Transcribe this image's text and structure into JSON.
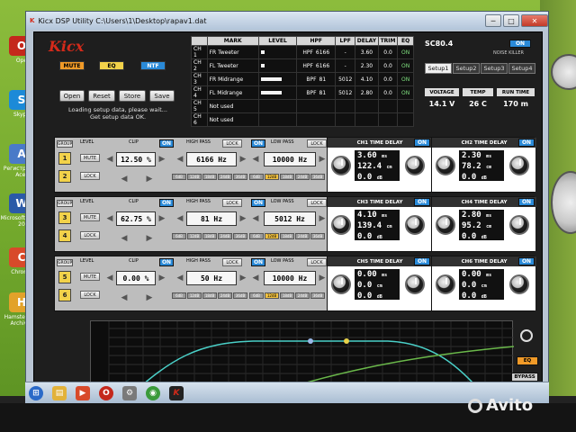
{
  "window": {
    "title": "Kicx DSP Utility   C:\\Users\\1\\Desktop\\rapav1.dat",
    "minimize": "─",
    "maximize": "□",
    "close": "✕"
  },
  "desktop_icons": [
    {
      "label": "Ope",
      "glyph": "O",
      "color": "#c4281c"
    },
    {
      "label": "Skype",
      "glyph": "S",
      "color": "#1c8ad8"
    },
    {
      "label": "Регистрация Acer",
      "glyph": "A",
      "color": "#4a7ac8"
    },
    {
      "label": "Microsoft Office 20",
      "glyph": "W",
      "color": "#2a5aa8"
    },
    {
      "label": "Chrome",
      "glyph": "C",
      "color": "#d84a2a"
    },
    {
      "label": "Hamster Lite Archiver",
      "glyph": "H",
      "color": "#e2a22a"
    }
  ],
  "header": {
    "logo": "Kicx",
    "mute_label": "MUTE",
    "eq_label": "EQ",
    "ntf_label": "NTF",
    "buttons": {
      "open": "Open",
      "reset": "Reset",
      "store": "Store",
      "save": "Save"
    },
    "status_lines": [
      "Loading setup data, please wait...",
      "Get setup data OK."
    ]
  },
  "channel_table": {
    "headers": [
      "",
      "MARK",
      "LEVEL",
      "HPF",
      "LPF",
      "DELAY",
      "TRIM",
      "EQ"
    ],
    "rows": [
      {
        "ch": "CH 1",
        "mark": "FR Tweeter",
        "level": 0.1,
        "hpf": "HPF",
        "hpf_val": "6166",
        "lpf": "-",
        "delay": "3.60",
        "trim": "0.0",
        "eq": "ON"
      },
      {
        "ch": "CH 2",
        "mark": "FL Tweeter",
        "level": 0.1,
        "hpf": "HPF",
        "hpf_val": "6166",
        "lpf": "-",
        "delay": "2.30",
        "trim": "0.0",
        "eq": "ON"
      },
      {
        "ch": "CH 3",
        "mark": "FR Midrange",
        "level": 0.6,
        "hpf": "BPF",
        "hpf_val": "81",
        "lpf": "5012",
        "delay": "4.10",
        "trim": "0.0",
        "eq": "ON"
      },
      {
        "ch": "CH 4",
        "mark": "FL Midrange",
        "level": 0.6,
        "hpf": "BPF",
        "hpf_val": "81",
        "lpf": "5012",
        "delay": "2.80",
        "trim": "0.0",
        "eq": "ON"
      },
      {
        "ch": "CH 5",
        "mark": "Not used",
        "level": 0.0,
        "hpf": "",
        "hpf_val": "",
        "lpf": "",
        "delay": "",
        "trim": "",
        "eq": ""
      },
      {
        "ch": "CH 6",
        "mark": "Not used",
        "level": 0.0,
        "hpf": "",
        "hpf_val": "",
        "lpf": "",
        "delay": "",
        "trim": "",
        "eq": ""
      }
    ]
  },
  "device": {
    "model": "SC80.4",
    "power": "ON",
    "noise_killer": "NOISE KILLER",
    "setups": [
      "Setup1",
      "Setup2",
      "Setup3",
      "Setup4"
    ],
    "readouts": [
      {
        "head": "VOLTAGE",
        "value": "14.1 V"
      },
      {
        "head": "TEMP",
        "value": "26 C"
      },
      {
        "head": "RUN TIME",
        "value": "170 m"
      }
    ]
  },
  "groups": [
    {
      "group_label": "GROUP",
      "nums": [
        "1",
        "2"
      ],
      "level_label": "LEVEL",
      "clip_label": "CLIP",
      "on_label": "ON",
      "mute_label": "MUTE",
      "lock_label": "LOCK",
      "level_value": "12.50 %",
      "hp_label": "HIGH PASS",
      "hp_lock": "LOCK",
      "hp_value": "6166 Hz",
      "lp_on": "ON",
      "lp_label": "LOW PASS",
      "lp_lock": "LOCK",
      "lp_value": "10000 Hz",
      "slopes": [
        "6dB",
        "12dB",
        "18dB",
        "24dB",
        "36dB"
      ],
      "td_a": {
        "title": "CH1 TIME DELAY",
        "on": "ON",
        "ms": "3.60",
        "cm": "122.4",
        "db": "0.0"
      },
      "td_b": {
        "title": "CH2 TIME DELAY",
        "on": "ON",
        "ms": "2.30",
        "cm": "78.2",
        "db": "0.0"
      }
    },
    {
      "group_label": "GROUP",
      "nums": [
        "3",
        "4"
      ],
      "level_label": "LEVEL",
      "clip_label": "CLIP",
      "on_label": "ON",
      "mute_label": "MUTE",
      "lock_label": "LOCK",
      "level_value": "62.75 %",
      "hp_label": "HIGH PASS",
      "hp_lock": "LOCK",
      "hp_value": "81 Hz",
      "lp_on": "ON",
      "lp_label": "LOW PASS",
      "lp_lock": "LOCK",
      "lp_value": "5012 Hz",
      "slopes": [
        "6dB",
        "12dB",
        "18dB",
        "24dB",
        "36dB"
      ],
      "td_a": {
        "title": "CH3 TIME DELAY",
        "on": "ON",
        "ms": "4.10",
        "cm": "139.4",
        "db": "0.0"
      },
      "td_b": {
        "title": "CH4 TIME DELAY",
        "on": "ON",
        "ms": "2.80",
        "cm": "95.2",
        "db": "0.0"
      }
    },
    {
      "group_label": "GROUP",
      "nums": [
        "5",
        "6"
      ],
      "level_label": "LEVEL",
      "clip_label": "CLIP",
      "on_label": "ON",
      "mute_label": "MUTE",
      "lock_label": "LOCK",
      "level_value": "0.00 %",
      "hp_label": "HIGH PASS",
      "hp_lock": "LOCK",
      "hp_value": "50 Hz",
      "lp_on": "ON",
      "lp_label": "LOW PASS",
      "lp_lock": "LOCK",
      "lp_value": "10000 Hz",
      "slopes": [
        "6dB",
        "12dB",
        "18dB",
        "24dB",
        "36dB"
      ],
      "td_a": {
        "title": "CH5 TIME DELAY",
        "on": "ON",
        "ms": "0.00",
        "cm": "0.0",
        "db": "0.0"
      },
      "td_b": {
        "title": "CH6 TIME DELAY",
        "on": "ON",
        "ms": "0.00",
        "cm": "0.0",
        "db": "0.0"
      }
    }
  ],
  "graph": {
    "eq_label": "EQ",
    "bypass_label": "BYPASS",
    "zoom_icon": "zoom-icon"
  },
  "taskbar": {
    "icons": [
      "start-orb-icon",
      "explorer-icon",
      "media-icon",
      "opera-icon",
      "tools-icon",
      "chrome-icon",
      "kicx-icon"
    ]
  },
  "watermark": "Avito",
  "colors": {
    "accent": "#2a8ad8",
    "mute": "#f09a28",
    "eq": "#f2d24a",
    "curve_a": "#4ad0c8",
    "curve_b": "#6ab84a"
  }
}
